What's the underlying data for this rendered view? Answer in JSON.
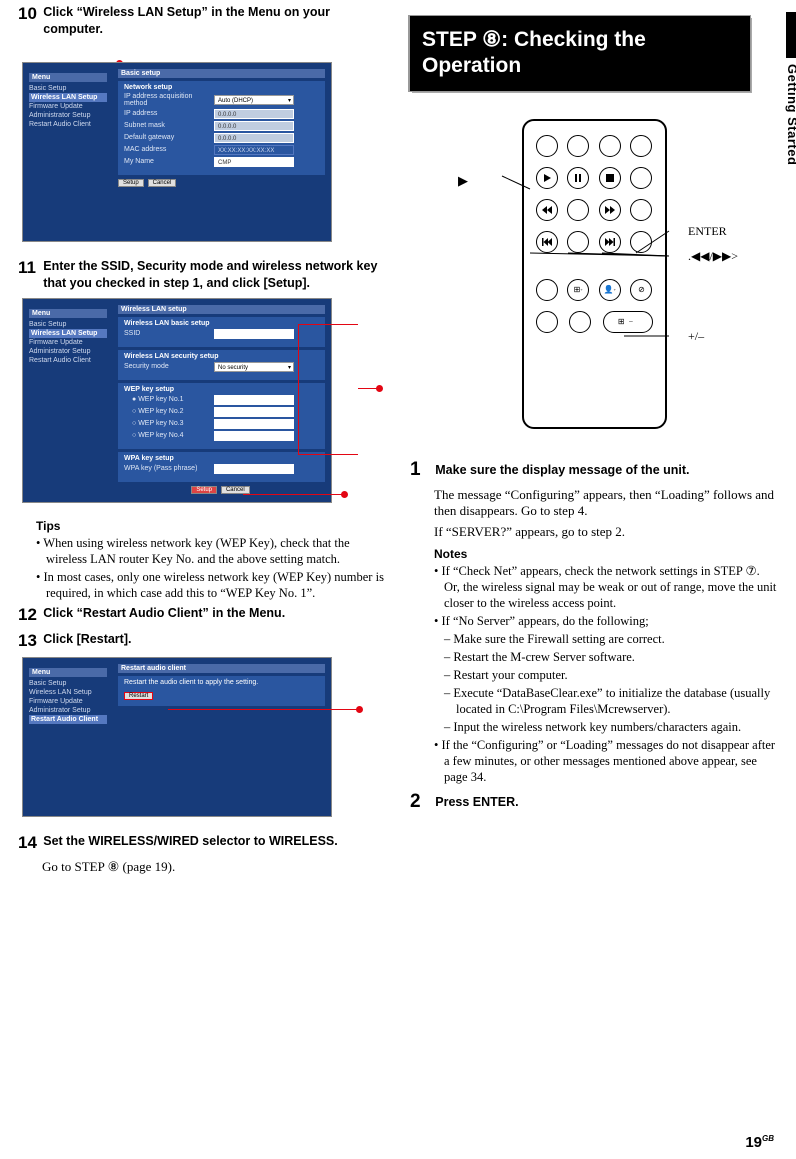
{
  "sideTab": "Getting Started",
  "pageNum": "19",
  "pageSuffix": "GB",
  "left": {
    "step10": {
      "num": "10",
      "text": "Click “Wireless LAN Setup” in the Menu on your computer."
    },
    "step11": {
      "num": "11",
      "text": "Enter the SSID, Security mode and wireless network key that you checked in step 1, and click [Setup]."
    },
    "step12": {
      "num": "12",
      "text": "Click “Restart Audio Client” in the Menu."
    },
    "step13": {
      "num": "13",
      "text": "Click [Restart]."
    },
    "step14": {
      "num": "14",
      "text": "Set the WIRELESS/WIRED selector to WIRELESS."
    },
    "step14body": "Go to STEP ⑧ (page 19).",
    "tipsHeader": "Tips",
    "tips1": "• When using wireless network key (WEP Key), check that the wireless LAN router Key No. and the above setting match.",
    "tips2": "• In most cases, only one wireless network key (WEP Key) number is required, in which case add this to “WEP Key No. 1”.",
    "ss1": {
      "menuTitle": "Menu",
      "menuItems": [
        "Basic Setup",
        "Wireless LAN Setup",
        "Firmware Update",
        "Administrator Setup",
        "Restart Audio Client"
      ],
      "bodyTitle": "Basic setup",
      "panel": "Network setup",
      "rows": [
        {
          "lbl": "IP address acquisition method",
          "val": "Auto (DHCP)",
          "type": "sel"
        },
        {
          "lbl": "IP address",
          "val": "0.0.0.0"
        },
        {
          "lbl": "Subnet mask",
          "val": "0.0.0.0"
        },
        {
          "lbl": "Default gateway",
          "val": "0.0.0.0"
        },
        {
          "lbl": "MAC address",
          "val": "XX:XX:XX:XX:XX:XX"
        },
        {
          "lbl": "My Name",
          "val": "CMP"
        }
      ],
      "btn1": "Setup",
      "btn2": "Cancel"
    },
    "ss2": {
      "menuTitle": "Menu",
      "menuItems": [
        "Basic Setup",
        "Wireless LAN Setup",
        "Firmware Update",
        "Administrator Setup",
        "Restart Audio Client"
      ],
      "bodyTitle": "Wireless LAN setup",
      "sec1": "Wireless LAN basic setup",
      "lbl_ssid": "SSID",
      "sec2": "Wireless LAN security setup",
      "lbl_secmode": "Security mode",
      "val_secmode": "No security",
      "sec3": "WEP key setup",
      "wep": [
        "WEP key No.1",
        "WEP key No.2",
        "WEP key No.3",
        "WEP key No.4"
      ],
      "sec4": "WPA key setup",
      "lbl_wpa": "WPA key (Pass phrase)",
      "btn1": "Setup",
      "btn2": "Cancel"
    },
    "ss3": {
      "menuTitle": "Menu",
      "menuItems": [
        "Basic Setup",
        "Wireless LAN Setup",
        "Firmware Update",
        "Administrator Setup",
        "Restart Audio Client"
      ],
      "bodyTitle": "Restart audio client",
      "body": "Restart the audio client to apply the setting.",
      "btn": "Restart"
    }
  },
  "right": {
    "title": "STEP ⑧: Checking the Operation",
    "remoteLabels": {
      "play": "▶",
      "enter": "ENTER",
      "prevnext": ".◀◀/▶▶>",
      "plusminus": "+/–"
    },
    "step1num": "1",
    "step1text": "Make sure the display message of the unit.",
    "step1body1": "The message “Configuring” appears, then “Loading” follows and then disappears. Go to step 4.",
    "step1body2": "If “SERVER?” appears, go to step 2.",
    "notesHeader": "Notes",
    "note1": "• If “Check Net” appears, check the network settings in STEP ⑦. Or, the wireless signal may be weak or out of range, move the unit closer to the wireless access point.",
    "note2": "• If “No Server” appears, do the following;",
    "note2a": "– Make sure the Firewall setting are correct.",
    "note2b": "– Restart the M-crew Server software.",
    "note2c": "– Restart your computer.",
    "note2d": "– Execute “DataBaseClear.exe” to initialize the database (usually located in C:\\Program Files\\Mcrewserver).",
    "note2e": "– Input the wireless network key numbers/characters again.",
    "note3": "• If the “Configuring” or “Loading” messages do not disappear after a few minutes, or other messages mentioned above appear, see page 34.",
    "step2num": "2",
    "step2text": "Press ENTER."
  }
}
